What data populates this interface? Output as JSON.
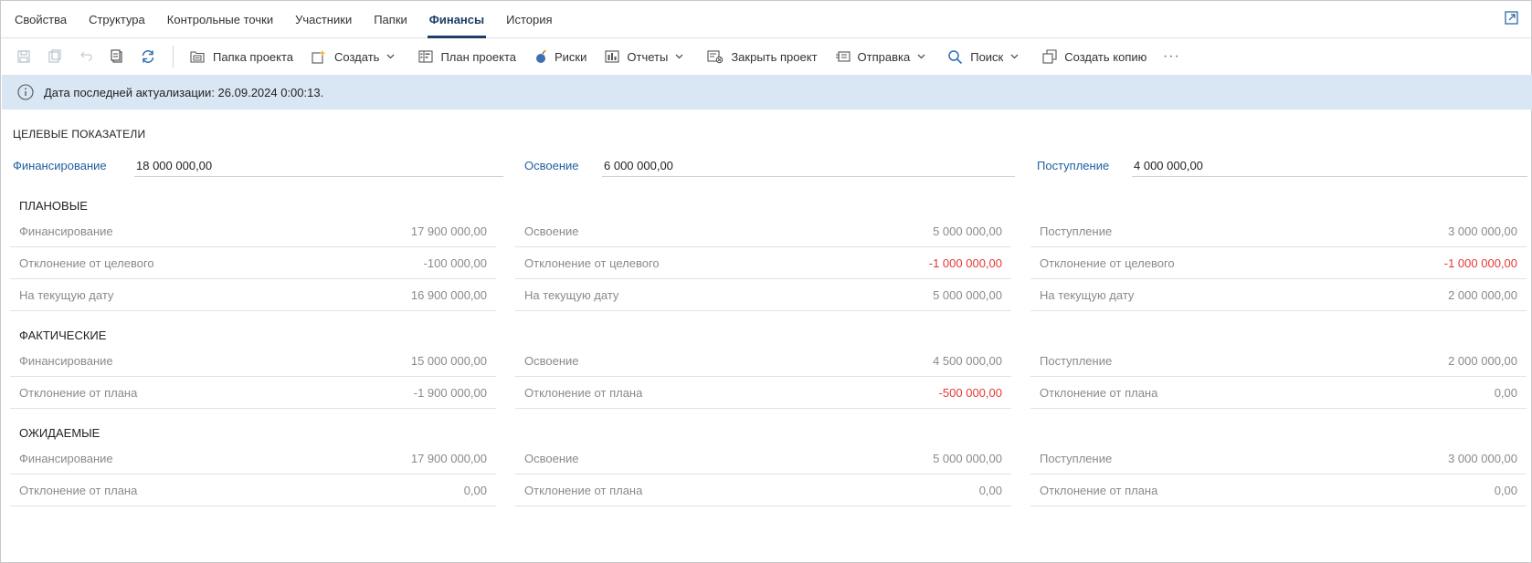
{
  "tabs": [
    {
      "label": "Свойства",
      "active": false
    },
    {
      "label": "Структура",
      "active": false
    },
    {
      "label": "Контрольные точки",
      "active": false
    },
    {
      "label": "Участники",
      "active": false
    },
    {
      "label": "Папки",
      "active": false
    },
    {
      "label": "Финансы",
      "active": true
    },
    {
      "label": "История",
      "active": false
    }
  ],
  "toolbar": {
    "project_folder": "Папка проекта",
    "create": "Создать",
    "project_plan": "План проекта",
    "risks": "Риски",
    "reports": "Отчеты",
    "close_project": "Закрыть проект",
    "send": "Отправка",
    "search": "Поиск",
    "make_copy": "Создать копию",
    "more": "···"
  },
  "info": {
    "text": "Дата последней актуализации: 26.09.2024 0:00:13."
  },
  "targets": {
    "title": "ЦЕЛЕВЫЕ ПОКАЗАТЕЛИ",
    "financing_label": "Финансирование",
    "financing_value": "18 000 000,00",
    "development_label": "Освоение",
    "development_value": "6 000 000,00",
    "receipt_label": "Поступление",
    "receipt_value": "4 000 000,00"
  },
  "planned": {
    "title": "ПЛАНОВЫЕ",
    "col1": [
      {
        "label": "Финансирование",
        "value": "17 900 000,00"
      },
      {
        "label": "Отклонение от целевого",
        "value": "-100 000,00"
      },
      {
        "label": "На текущую дату",
        "value": "16 900 000,00"
      }
    ],
    "col2": [
      {
        "label": "Освоение",
        "value": "5 000 000,00"
      },
      {
        "label": "Отклонение от целевого",
        "value": "-1 000 000,00"
      },
      {
        "label": "На текущую дату",
        "value": "5 000 000,00"
      }
    ],
    "col3": [
      {
        "label": "Поступление",
        "value": "3 000 000,00"
      },
      {
        "label": "Отклонение от целевого",
        "value": "-1 000 000,00"
      },
      {
        "label": "На текущую дату",
        "value": "2 000 000,00"
      }
    ]
  },
  "actual": {
    "title": "ФАКТИЧЕСКИЕ",
    "col1": [
      {
        "label": "Финансирование",
        "value": "15 000 000,00"
      },
      {
        "label": "Отклонение от плана",
        "value": "-1 900 000,00"
      }
    ],
    "col2": [
      {
        "label": "Освоение",
        "value": "4 500 000,00"
      },
      {
        "label": "Отклонение от плана",
        "value": "-500 000,00"
      }
    ],
    "col3": [
      {
        "label": "Поступление",
        "value": "2 000 000,00"
      },
      {
        "label": "Отклонение от плана",
        "value": "0,00"
      }
    ]
  },
  "expected": {
    "title": "ОЖИДАЕМЫЕ",
    "col1": [
      {
        "label": "Финансирование",
        "value": "17 900 000,00"
      },
      {
        "label": "Отклонение от плана",
        "value": "0,00"
      }
    ],
    "col2": [
      {
        "label": "Освоение",
        "value": "5 000 000,00"
      },
      {
        "label": "Отклонение от плана",
        "value": "0,00"
      }
    ],
    "col3": [
      {
        "label": "Поступление",
        "value": "3 000 000,00"
      },
      {
        "label": "Отклонение от плана",
        "value": "0,00"
      }
    ]
  },
  "colors": {
    "accent": "#1f3d66",
    "link": "#1f5f9e",
    "negative": "#e53935",
    "info_bg": "#d9e6f3"
  }
}
